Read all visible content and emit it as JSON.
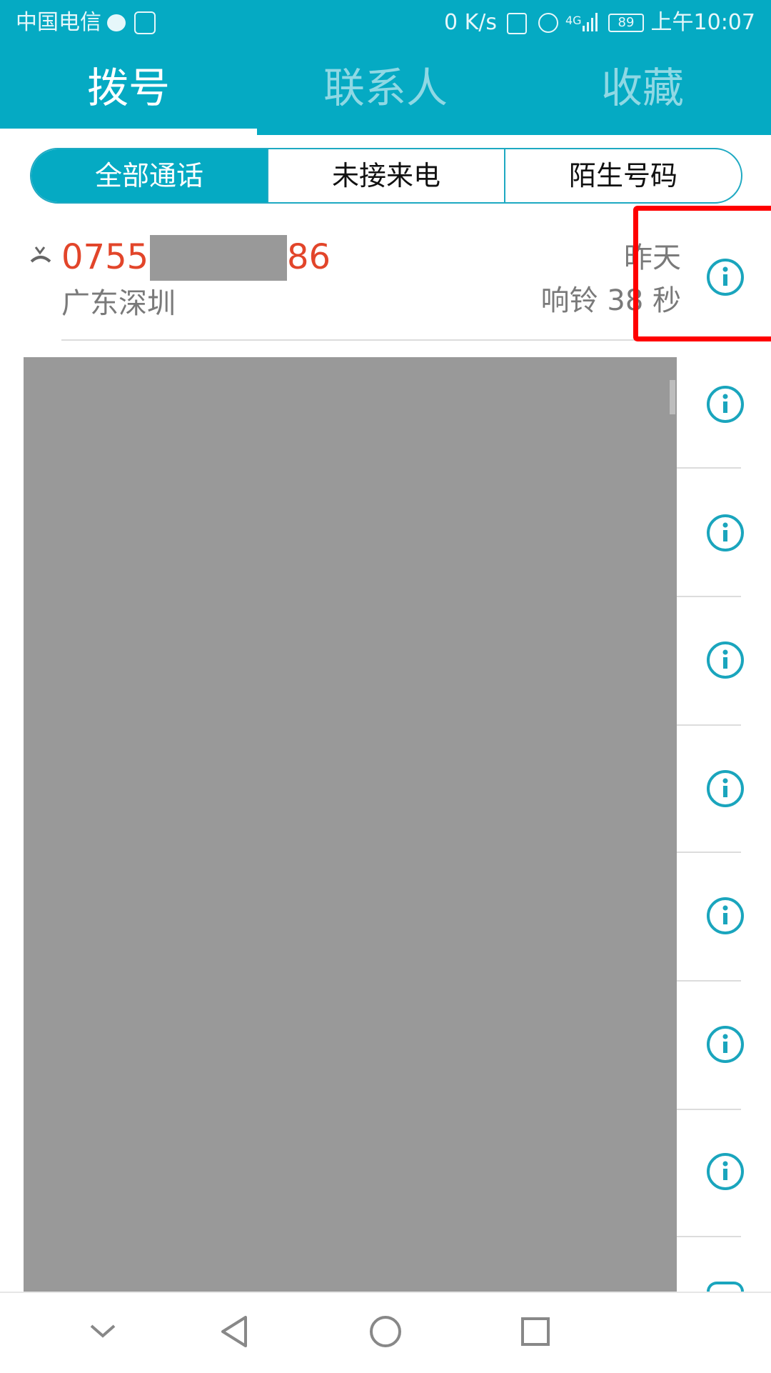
{
  "status_bar": {
    "carrier": "中国电信",
    "speed": "0 K/s",
    "network": "4G",
    "battery": "89",
    "time": "上午10:07"
  },
  "tabs": [
    "拨号",
    "联系人",
    "收藏"
  ],
  "filter": [
    "全部通话",
    "未接来电",
    "陌生号码"
  ],
  "calls": [
    {
      "number_prefix": "0755",
      "number_suffix": "86",
      "location": "广东深圳",
      "date": "昨天",
      "detail": "响铃 38 秒",
      "type": "missed"
    }
  ],
  "colors": {
    "accent": "#05aac3",
    "missed": "#e2452a",
    "highlight": "#ff0000"
  },
  "icons": {
    "info": "info-icon",
    "missed_call": "missed-call-icon"
  }
}
